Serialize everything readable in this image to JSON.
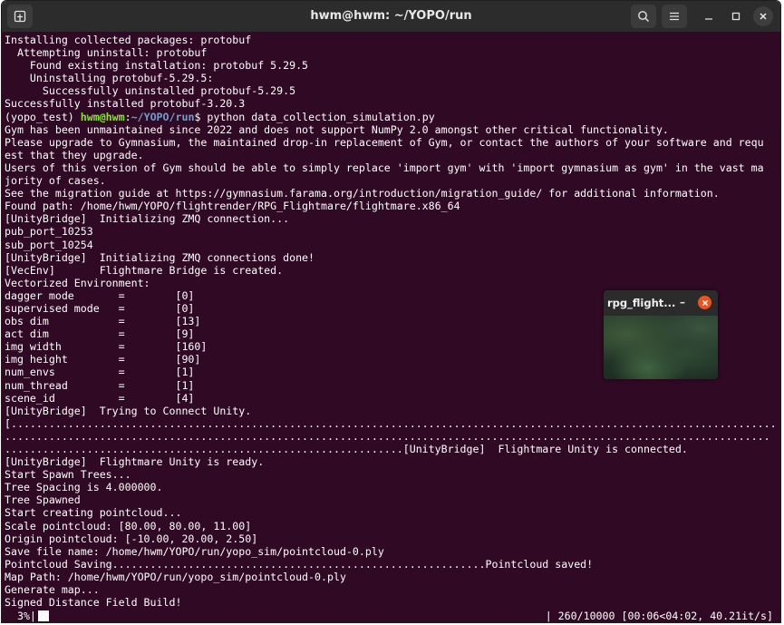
{
  "window": {
    "title": "hwm@hwm: ~/YOPO/run"
  },
  "terminal": {
    "lines_before_prompt": [
      "Installing collected packages: protobuf",
      "  Attempting uninstall: protobuf",
      "    Found existing installation: protobuf 5.29.5",
      "    Uninstalling protobuf-5.29.5:",
      "      Successfully uninstalled protobuf-5.29.5",
      "Successfully installed protobuf-3.20.3"
    ],
    "prompt": {
      "env": "(yopo_test) ",
      "user_host": "hwm@hwm",
      "colon": ":",
      "path": "~/YOPO/run",
      "dollar": "$ ",
      "command": "python data_collection_simulation.py"
    },
    "lines_after_prompt": [
      "Gym has been unmaintained since 2022 and does not support NumPy 2.0 amongst other critical functionality.",
      "Please upgrade to Gymnasium, the maintained drop-in replacement of Gym, or contact the authors of your software and requ",
      "est that they upgrade.",
      "Users of this version of Gym should be able to simply replace 'import gym' with 'import gymnasium as gym' in the vast ma",
      "jority of cases.",
      "See the migration guide at https://gymnasium.farama.org/introduction/migration_guide/ for additional information.",
      "Found path: /home/hwm/YOPO/flightrender/RPG_Flightmare/flightmare.x86_64",
      "[UnityBridge]  Initializing ZMQ connection...",
      "pub_port_10253",
      "sub_port_10254",
      "[UnityBridge]  Initializing ZMQ connections done!",
      "[VecEnv]       Flightmare Bridge is created.",
      "Vectorized Environment:",
      "dagger mode       =        [0]",
      "supervised mode   =        [0]",
      "obs dim           =        [13]",
      "act dim           =        [9]",
      "img width         =        [160]",
      "img height        =        [90]",
      "num_envs          =        [1]",
      "num_thread        =        [1]",
      "scene_id          =        [4]",
      "[UnityBridge]  Trying to Connect Unity.",
      "[.........................................................................................................................",
      ".........................................................................................................................",
      "...............................................................[UnityBridge]  Flightmare Unity is connected.",
      "[UnityBridge]  Flightmare Unity is ready.",
      "Start Spawn Trees...",
      "Tree Spacing is 4.000000.",
      "Tree Spawned",
      "Start creating pointcloud...",
      "Scale pointcloud: [80.00, 80.00, 11.00]",
      "Origin pointcloud: [-10.00, 20.00, 2.50]",
      "Save file name: /home/hwm/YOPO/run/yopo_sim/pointcloud-0.ply",
      "Pointcloud Saving...........................................................Pointcloud saved!",
      "Map Path: /home/hwm/YOPO/run/yopo_sim/pointcloud-0.ply",
      "Generate map...",
      "Signed Distance Field Build!"
    ],
    "progress_left": "  3%|",
    "progress_right": "| 260/10000 [00:06<04:02, 40.21it/s]",
    "progress_fraction": 0.026
  },
  "popup": {
    "title": "rpg_flight...",
    "min_glyph": "–"
  },
  "colors": {
    "terminal_bg": "#300a24",
    "titlebar_bg": "#2c2c2c",
    "prompt_user": "#8ae234",
    "prompt_path": "#729fcf",
    "close_accent": "#e95420"
  },
  "icons": {
    "new_tab": "new-tab-icon",
    "search": "search-icon",
    "menu": "hamburger-menu-icon",
    "minimize": "minimize-icon",
    "maximize": "maximize-icon",
    "close": "close-icon"
  }
}
